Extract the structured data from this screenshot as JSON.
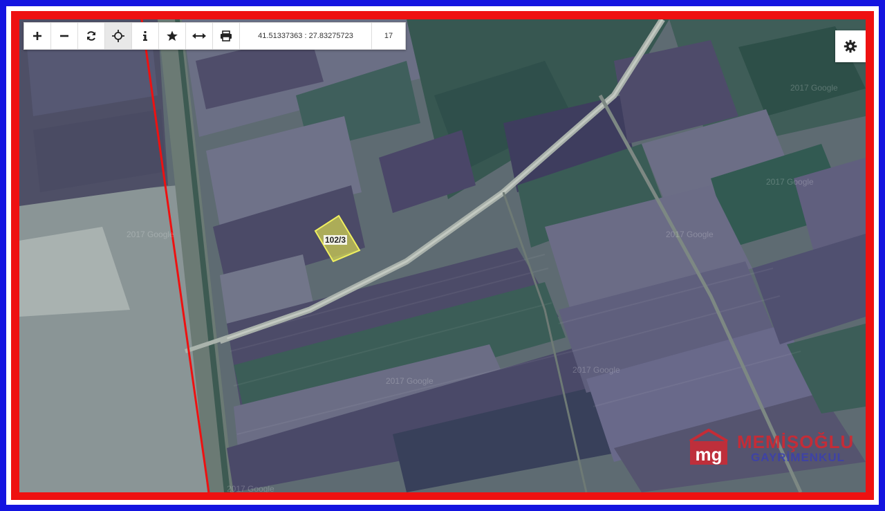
{
  "toolbar": {
    "buttons": [
      {
        "name": "zoom-in-button",
        "icon": "plus-icon"
      },
      {
        "name": "zoom-out-button",
        "icon": "minus-icon"
      },
      {
        "name": "refresh-button",
        "icon": "refresh-icon"
      },
      {
        "name": "locate-button",
        "icon": "crosshair-icon",
        "active": true
      },
      {
        "name": "info-button",
        "icon": "info-icon"
      },
      {
        "name": "favorite-button",
        "icon": "star-icon"
      },
      {
        "name": "measure-button",
        "icon": "arrows-horizontal-icon"
      },
      {
        "name": "print-button",
        "icon": "printer-icon"
      }
    ],
    "coordinates": "41.51337363 : 27.83275723",
    "zoom_level": "17"
  },
  "settings": {
    "icon": "gear-icon"
  },
  "parcel": {
    "label": "102/3",
    "color": "#e5e56a"
  },
  "boundary_line_color": "#ee1111",
  "watermark_text": "2017 Google",
  "brand": {
    "name": "MEMİŞOĞLU",
    "subtitle": "GAYRİMENKUL",
    "logo_text": "mg",
    "primary_color": "#d8262e",
    "secondary_color": "#3a3fb0"
  },
  "frame_colors": {
    "outer": "#1414e0",
    "inner": "#ee1111"
  }
}
